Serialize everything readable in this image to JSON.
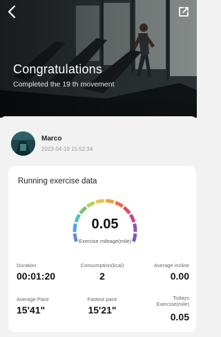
{
  "header": {
    "title": "Congratulations",
    "subtitle": "Completed the 19 th movement"
  },
  "user": {
    "name": "Marco",
    "timestamp": "2023-04-19 15:52:34"
  },
  "card": {
    "title": "Running exercise data",
    "gauge": {
      "value": "0.05",
      "label": "Exercise mileage(mile)",
      "segment_colors": [
        "#6b8ad6",
        "#4fa3e0",
        "#55c0c4",
        "#76c36a",
        "#b7cf5a",
        "#e8c54a",
        "#f0a041",
        "#ea6d45",
        "#df4b67",
        "#c6458f",
        "#9a4fb8",
        "#6f5ec8"
      ]
    },
    "stats": [
      {
        "label": "Duration",
        "value": "00:01:20"
      },
      {
        "label": "Consumption(kcal)",
        "value": "2"
      },
      {
        "label": "Average incline",
        "value": "0.00"
      },
      {
        "label": "Average Pace",
        "value": "15'41\""
      },
      {
        "label": "Fastest pace",
        "value": "15'21\""
      },
      {
        "label": "Todays Exercise(mile)",
        "value": "0.05"
      }
    ]
  },
  "icons": {
    "back": "chevron-left-icon",
    "share": "share-icon"
  }
}
